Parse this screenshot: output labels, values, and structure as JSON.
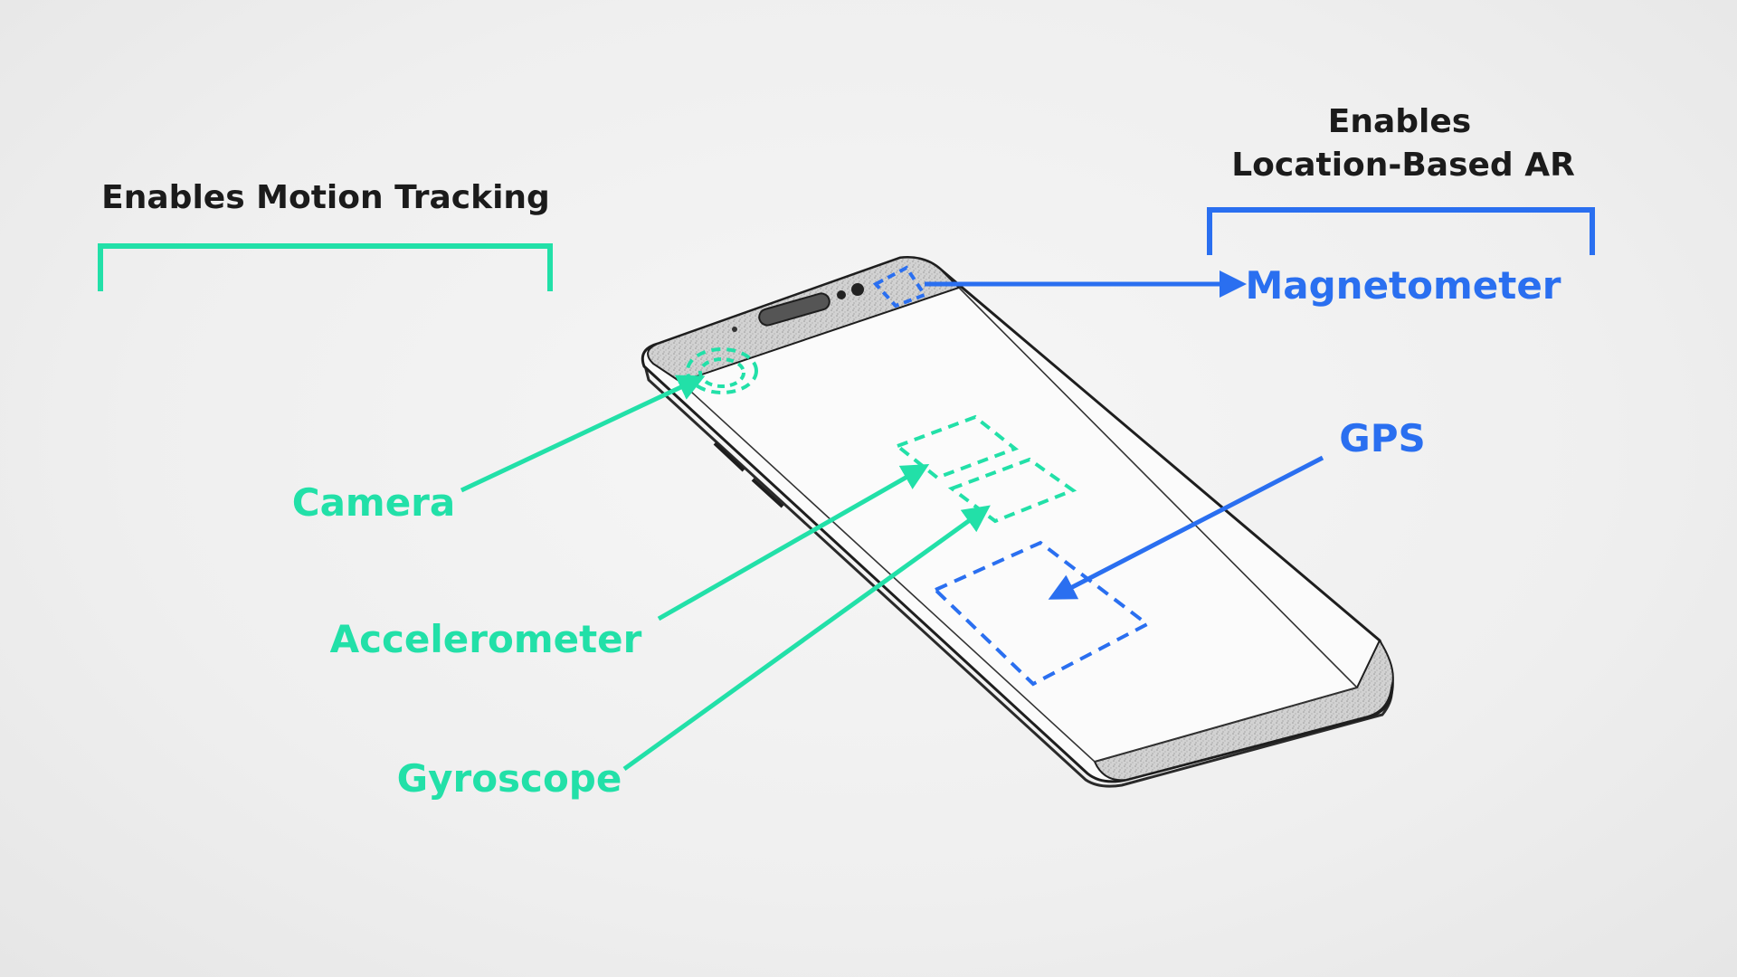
{
  "colors": {
    "green": "#22e0a8",
    "blue": "#2a6ff0",
    "ink": "#1b1b1b"
  },
  "groups": {
    "motion_tracking": {
      "title": "Enables Motion Tracking"
    },
    "location_ar": {
      "title_line1": "Enables",
      "title_line2": "Location-Based AR"
    }
  },
  "sensors": {
    "camera": "Camera",
    "accelerometer": "Accelerometer",
    "gyroscope": "Gyroscope",
    "magnetometer": "Magnetometer",
    "gps": "GPS"
  }
}
